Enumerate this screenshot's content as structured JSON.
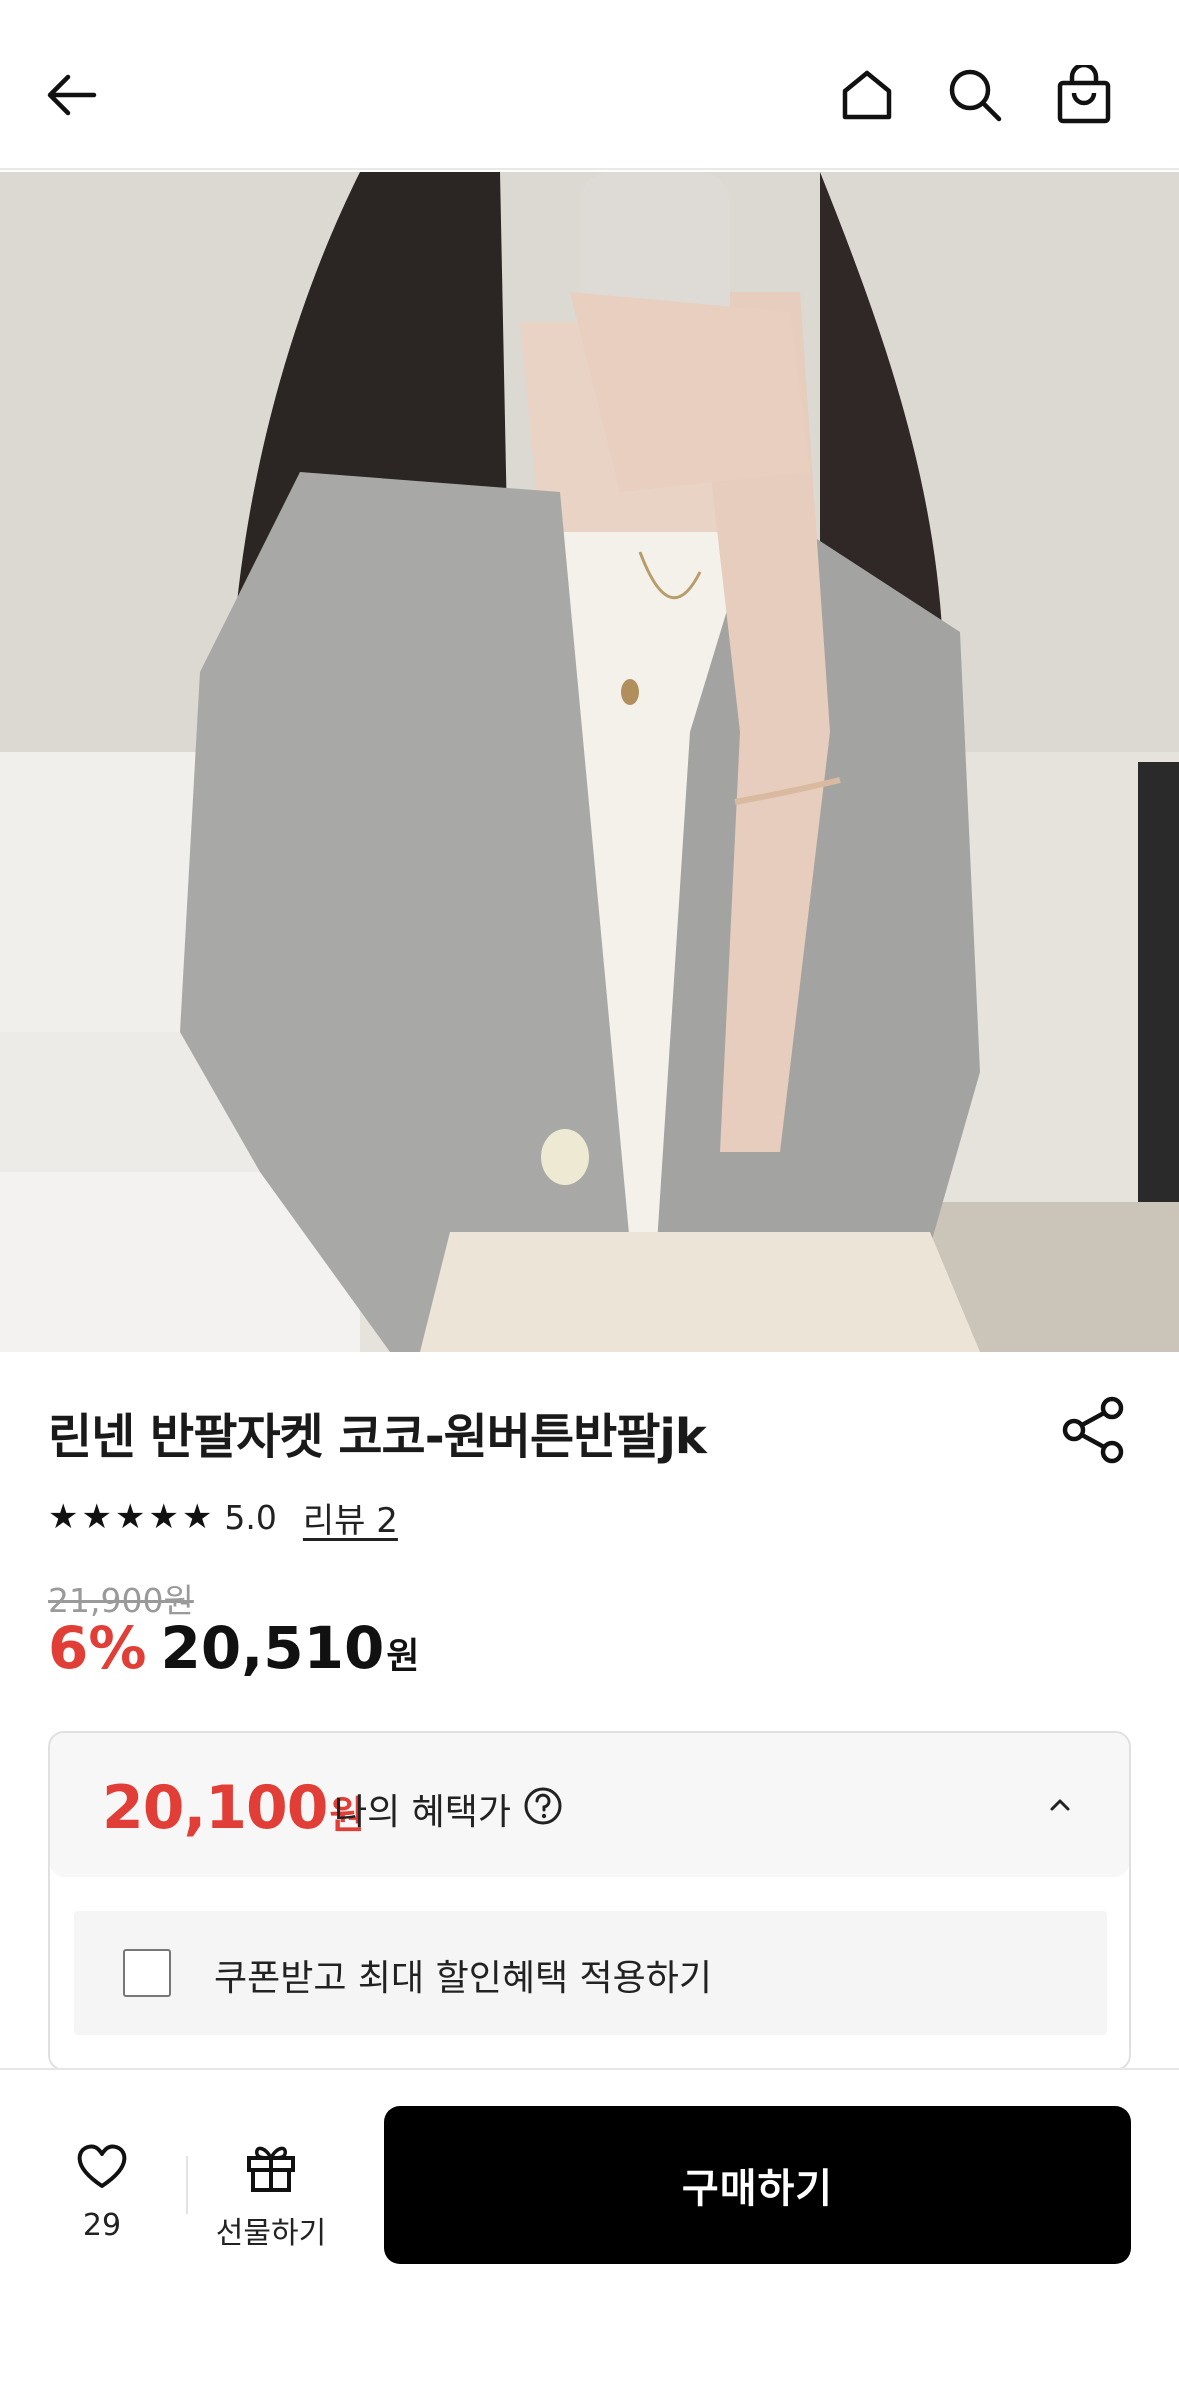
{
  "header": {
    "back_icon": "arrow-left-icon",
    "home_icon": "home-icon",
    "search_icon": "search-icon",
    "cart_icon": "shopping-bag-icon"
  },
  "product": {
    "image_alt": "product photo",
    "title": "린넨 반팔자켓 코코-원버튼반팔jk",
    "rating": {
      "stars": 5,
      "value": "5.0",
      "review_link": "리뷰 2"
    },
    "original_price": "21,900원",
    "discount": "6%",
    "sale_price": "20,510",
    "currency": "원"
  },
  "benefit": {
    "price": "20,100",
    "currency": "원",
    "label": "나의 혜택가",
    "coupon_label": "쿠폰받고 최대 할인혜택 적용하기",
    "coupon_checked": false,
    "expanded": true
  },
  "bottom_bar": {
    "like_count": "29",
    "gift_label": "선물하기",
    "buy_label": "구매하기"
  },
  "colors": {
    "accent_red": "#e03e36",
    "buy_button": "#000000"
  }
}
